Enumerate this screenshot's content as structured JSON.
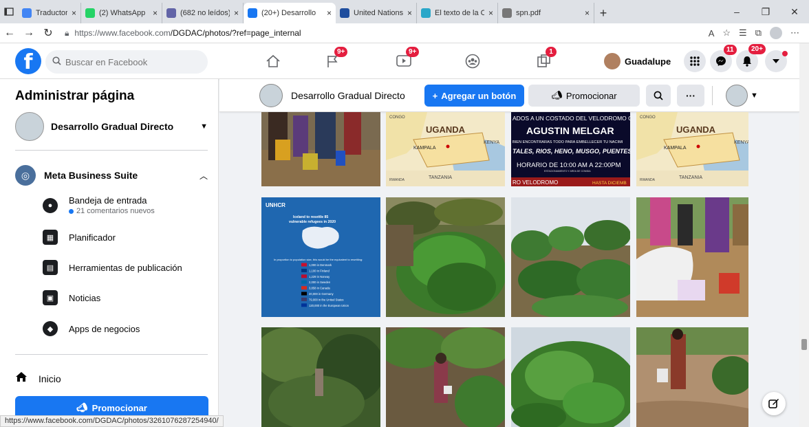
{
  "browser": {
    "tabs": [
      {
        "title": "Traductor de Goo",
        "fav_color": "#4285f4",
        "active": false
      },
      {
        "title": "(2) WhatsApp",
        "fav_color": "#25d366",
        "active": false
      },
      {
        "title": "(682 no leídos) -",
        "fav_color": "#6264a7",
        "active": false
      },
      {
        "title": "(20+) Desarrollo",
        "fav_color": "#1877f2",
        "active": true
      },
      {
        "title": "United Nations C",
        "fav_color": "#1f4e9e",
        "active": false
      },
      {
        "title": "El texto de la Cor",
        "fav_color": "#2aa7c9",
        "active": false
      },
      {
        "title": "spn.pdf",
        "fav_color": "#777777",
        "active": false
      }
    ],
    "tab_close": "×",
    "new_tab": "+",
    "url_prefix": "https://www.facebook.com",
    "url_path": "/DGDAC/photos/?ref=page_internal",
    "status_url": "https://www.facebook.com/DGDAC/photos/3261076287254940/"
  },
  "fb": {
    "search_placeholder": "Buscar en Facebook",
    "badges": {
      "pages": "9+",
      "watch": "9+",
      "gaming": "1",
      "messenger": "11",
      "notifications": "20+"
    },
    "user_name": "Guadalupe"
  },
  "sidebar": {
    "title": "Administrar página",
    "page_name": "Desarrollo Gradual Directo",
    "meta_suite": "Meta Business Suite",
    "items": [
      {
        "label": "Bandeja de entrada",
        "sub": "21 comentarios nuevos"
      },
      {
        "label": "Planificador"
      },
      {
        "label": "Herramientas de publicación"
      },
      {
        "label": "Noticias"
      },
      {
        "label": "Apps de negocios"
      }
    ],
    "inicio": "Inicio",
    "promote": "Promocionar"
  },
  "page_header": {
    "name": "Desarrollo Gradual Directo",
    "add_button": "Agregar un botón",
    "promote": "Promocionar"
  },
  "photos": {
    "map_labels": {
      "country": "UGANDA",
      "city": "KAMPALA",
      "region": "KENYA",
      "south": "TANZANIA",
      "west": "CONGO",
      "rw": "RWANDA"
    },
    "poster": {
      "line1": "ADOS A UN COSTADO DEL VELODROMO OLIM",
      "line2": "AGUSTIN MELGAR",
      "line3": "BIEN ENCONTRARAS TODO PARA EMBELLECER TU NACIMI",
      "line4": "TALES, RIOS, HENO, MUSGO, PUENTES",
      "line5": "HORARIO DE 10:00 AM A 22:00PM",
      "line6": "ESTACIONAMIENTO Y AREA DE COMIDA",
      "line7": "RO VELODROMO",
      "line8": "HASTA DICIEMB"
    },
    "unhcr": {
      "brand": "UNHCR",
      "headline": "Iceland to resettle 85 vulnerable refugees in 2020",
      "caption": "In proportion to population size, this would be the equivalent to resettling:",
      "rows": [
        "1,000 in Denmark",
        "1,100 in Finland",
        "1,229 in Norway",
        "2,000 in Sweden",
        "3,858 in Canada",
        "20,000 in Germany",
        "79,000 in the United States",
        "120,000 in the European Union"
      ]
    }
  }
}
